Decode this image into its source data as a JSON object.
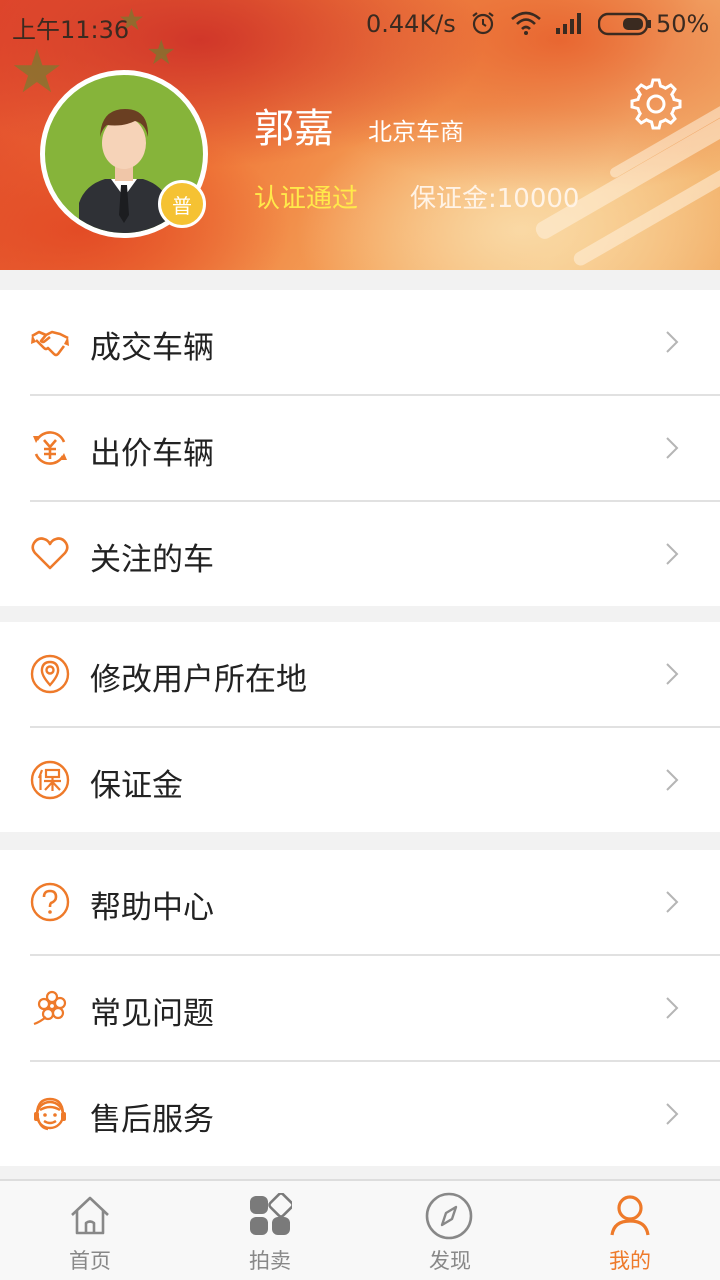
{
  "status_bar": {
    "time": "上午11:36",
    "net_speed": "0.44K/s",
    "battery": "50%"
  },
  "profile": {
    "name": "郭嘉",
    "role": "北京车商",
    "badge": "普",
    "cert_status": "认证通过",
    "deposit": "保证金:10000"
  },
  "menu_groups": [
    [
      {
        "label": "成交车辆",
        "icon": "handshake-icon"
      },
      {
        "label": "出价车辆",
        "icon": "yuan-exchange-icon"
      },
      {
        "label": "关注的车",
        "icon": "heart-icon"
      }
    ],
    [
      {
        "label": "修改用户所在地",
        "icon": "location-pin-icon"
      },
      {
        "label": "保证金",
        "icon": "deposit-icon"
      }
    ],
    [
      {
        "label": "帮助中心",
        "icon": "help-icon"
      },
      {
        "label": "常见问题",
        "icon": "flower-icon"
      },
      {
        "label": "售后服务",
        "icon": "customer-service-icon"
      }
    ]
  ],
  "bottom_nav": [
    {
      "label": "首页",
      "icon": "home-icon",
      "active": false
    },
    {
      "label": "拍卖",
      "icon": "grid-icon",
      "active": false
    },
    {
      "label": "发现",
      "icon": "compass-icon",
      "active": false
    },
    {
      "label": "我的",
      "icon": "person-icon",
      "active": true
    }
  ],
  "colors": {
    "accent": "#ee7a2a",
    "cert": "#ffe94a",
    "badge": "#f5c233",
    "avatar_bg": "#86b43a"
  }
}
